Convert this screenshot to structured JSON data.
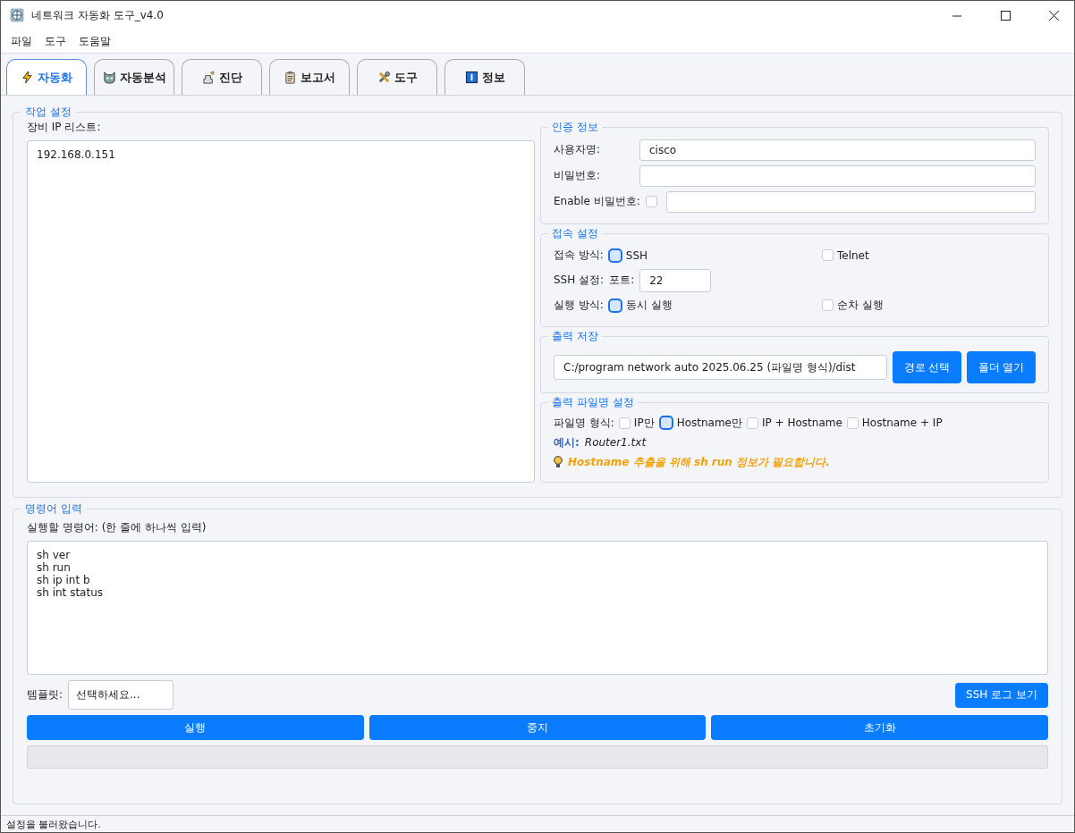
{
  "window": {
    "title": "네트워크 자동화 도구_v4.0"
  },
  "menu": [
    "파일",
    "도구",
    "도움말"
  ],
  "tabs": [
    {
      "label": "자동화",
      "kind": "bolt",
      "selected": true
    },
    {
      "label": "자동분석",
      "kind": "cat",
      "selected": false
    },
    {
      "label": "진단",
      "kind": "stamp",
      "selected": false
    },
    {
      "label": "보고서",
      "kind": "clipboard",
      "selected": false
    },
    {
      "label": "도구",
      "kind": "tools",
      "selected": false
    },
    {
      "label": "정보",
      "kind": "info",
      "selected": false
    }
  ],
  "job_settings": {
    "title": "작업 설정",
    "ip_label": "장비 IP 리스트:",
    "ip_list": "192.168.0.151"
  },
  "auth": {
    "title": "인증 정보",
    "username_label": "사용자명:",
    "username": "cisco",
    "password_label": "비밀번호:",
    "enable_label": "Enable 비밀번호:",
    "enable_checked": false
  },
  "connection": {
    "title": "접속 설정",
    "method_label": "접속 방식:",
    "methods": [
      {
        "label": "SSH",
        "selected": true
      },
      {
        "label": "Telnet",
        "selected": false
      }
    ],
    "ssh_label": "SSH 설정:",
    "port_label": "포트:",
    "port": "22",
    "exec_label": "실행 방식:",
    "exec_modes": [
      {
        "label": "동시 실행",
        "selected": true
      },
      {
        "label": "순차 실행",
        "selected": false
      }
    ]
  },
  "output": {
    "title": "출력 저장",
    "path": "C:/program network auto 2025.06.25 (파일명 형식)/dist",
    "buttons": [
      "경로 선택",
      "폴더 열기"
    ]
  },
  "filename": {
    "title": "출력 파일명 설정",
    "format_label": "파일명 형식:",
    "formats": [
      {
        "label": "IP만",
        "selected": false
      },
      {
        "label": "Hostname만",
        "selected": true
      },
      {
        "label": "IP + Hostname",
        "selected": false
      },
      {
        "label": "Hostname + IP",
        "selected": false
      }
    ],
    "example_label": "예시:",
    "example": "Router1.txt",
    "hint": "Hostname 추출을 위해 sh run 정보가 필요합니다."
  },
  "commands": {
    "title": "명령어 입력",
    "label": "실행할 명령어: (한 줄에 하나씩 입력)",
    "text": "sh ver\nsh run\nsh ip int b\nsh int status",
    "template_label": "템플릿:",
    "template": "선택하세요...",
    "log_button": "SSH 로그 보기",
    "actions": [
      "실행",
      "중지",
      "초기화"
    ],
    "progress": {
      "level": 0
    }
  },
  "status_bar": "설정을 불러왔습니다."
}
